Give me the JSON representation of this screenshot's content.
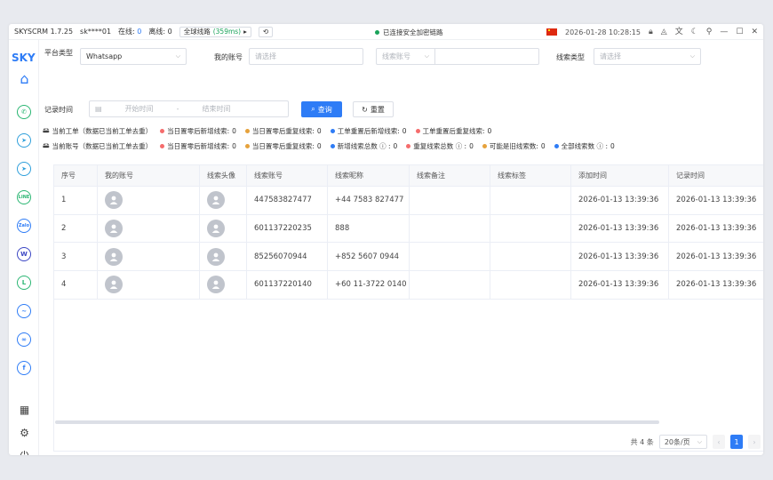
{
  "titlebar": {
    "app": "SKYSCRM 1.7.25",
    "account": "sk****01",
    "online_label": "在线:",
    "online_count": "0",
    "offline_label": "离线:",
    "offline_count": "0",
    "route_label": "全球线路",
    "route_latency": "(359ms)",
    "secure_text": "已连接安全加密链路",
    "datetime": "2026-01-28 10:28:15"
  },
  "sidebar": {
    "logo": "SKY"
  },
  "filters": {
    "platform_label": "平台类型",
    "platform_value": "Whatsapp",
    "my_account_label": "我的账号",
    "my_account_placeholder": "请选择",
    "lead_account_select": "线索账号",
    "lead_type_label": "线索类型",
    "lead_type_placeholder": "请选择",
    "record_time_label": "记录时间",
    "start_placeholder": "开始时间",
    "range_sep": "-",
    "end_placeholder": "结束时间",
    "query_button": "查询",
    "reset_button": "重置"
  },
  "stats1": {
    "head": "当前工单（数据已当前工单去重）",
    "items": [
      {
        "text": "当日置零后新增线索:",
        "value": "0",
        "color": "#f56c6c"
      },
      {
        "text": "当日置零后重复线索:",
        "value": "0",
        "color": "#e6a23c"
      },
      {
        "text": "工单重置后新增线索:",
        "value": "0",
        "color": "#2e7cf6"
      },
      {
        "text": "工单重置后重复线索:",
        "value": "0",
        "color": "#f56c6c"
      }
    ]
  },
  "stats2": {
    "head": "当前账号（数据已当前工单去重）",
    "items": [
      {
        "text": "当日置零后新增线索:",
        "value": "0",
        "color": "#f56c6c"
      },
      {
        "text": "当日置零后重复线索:",
        "value": "0",
        "color": "#e6a23c"
      },
      {
        "text": "新增线索总数 ⓘ :",
        "value": "0",
        "color": "#2e7cf6"
      },
      {
        "text": "重复线索总数 ⓘ :",
        "value": "0",
        "color": "#f56c6c"
      },
      {
        "text": "可能是旧线索数:",
        "value": "0",
        "color": "#e6a23c"
      },
      {
        "text": "全部线索数 ⓘ :",
        "value": "0",
        "color": "#2e7cf6"
      }
    ]
  },
  "table": {
    "columns": [
      "序号",
      "我的账号",
      "线索头像",
      "线索账号",
      "线索昵称",
      "线索备注",
      "线索标签",
      "添加时间",
      "记录时间"
    ],
    "rows": [
      [
        "1",
        "",
        "",
        "447583827477",
        "+44 7583 827477",
        "",
        "",
        "2026-01-13 13:39:36",
        "2026-01-13 13:39:36"
      ],
      [
        "2",
        "",
        "",
        "601137220235",
        "888",
        "",
        "",
        "2026-01-13 13:39:36",
        "2026-01-13 13:39:36"
      ],
      [
        "3",
        "",
        "",
        "85256070944",
        "+852 5607 0944",
        "",
        "",
        "2026-01-13 13:39:36",
        "2026-01-13 13:39:36"
      ],
      [
        "4",
        "",
        "",
        "601137220140",
        "+60 11-3722 0140",
        "",
        "",
        "2026-01-13 13:39:36",
        "2026-01-13 13:39:36"
      ]
    ]
  },
  "pagination": {
    "total": "共 4 条",
    "page_size": "20条/页",
    "current": "1"
  }
}
